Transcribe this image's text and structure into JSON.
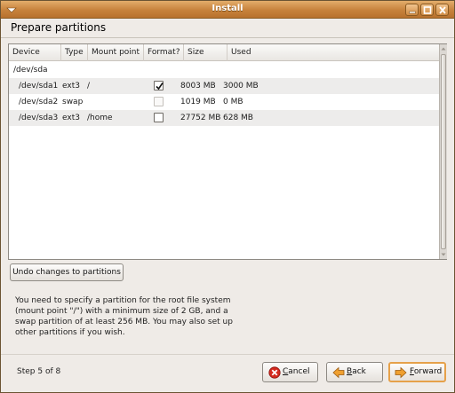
{
  "window": {
    "title": "Install"
  },
  "page": {
    "heading": "Prepare partitions"
  },
  "table": {
    "columns": [
      "Device",
      "Type",
      "Mount point",
      "Format?",
      "Size",
      "Used"
    ],
    "disk": "/dev/sda",
    "rows": [
      {
        "device": "/dev/sda1",
        "type": "ext3",
        "mount": "/",
        "format": true,
        "format_enabled": true,
        "size": "8003 MB",
        "used": "3000 MB"
      },
      {
        "device": "/dev/sda2",
        "type": "swap",
        "mount": "",
        "format": false,
        "format_enabled": false,
        "size": "1019 MB",
        "used": "0 MB"
      },
      {
        "device": "/dev/sda3",
        "type": "ext3",
        "mount": "/home",
        "format": false,
        "format_enabled": true,
        "size": "27752 MB",
        "used": "628 MB"
      }
    ]
  },
  "undo_button": {
    "label": "Undo changes to partitions"
  },
  "info_text": "You need to specify a partition for the root file system (mount point \"/\") with a minimum size of 2 GB, and a swap partition of at least 256 MB. You may also set up other partitions if you wish.",
  "footer": {
    "step": "Step 5 of 8",
    "cancel": {
      "mnemonic": "C",
      "rest": "ancel"
    },
    "back": {
      "mnemonic": "B",
      "rest": "ack"
    },
    "forward": {
      "mnemonic": "F",
      "rest": "orward"
    }
  },
  "icons": {
    "window_menu": "window-menu-icon",
    "minimize": "minimize-icon",
    "maximize": "maximize-icon",
    "close": "close-icon",
    "cancel": "cancel-icon",
    "back": "back-arrow-icon",
    "forward": "forward-arrow-icon",
    "check": "checkmark-icon"
  },
  "colors": {
    "titlebar": "#c7823c",
    "default_button_border": "#e6a14a"
  }
}
